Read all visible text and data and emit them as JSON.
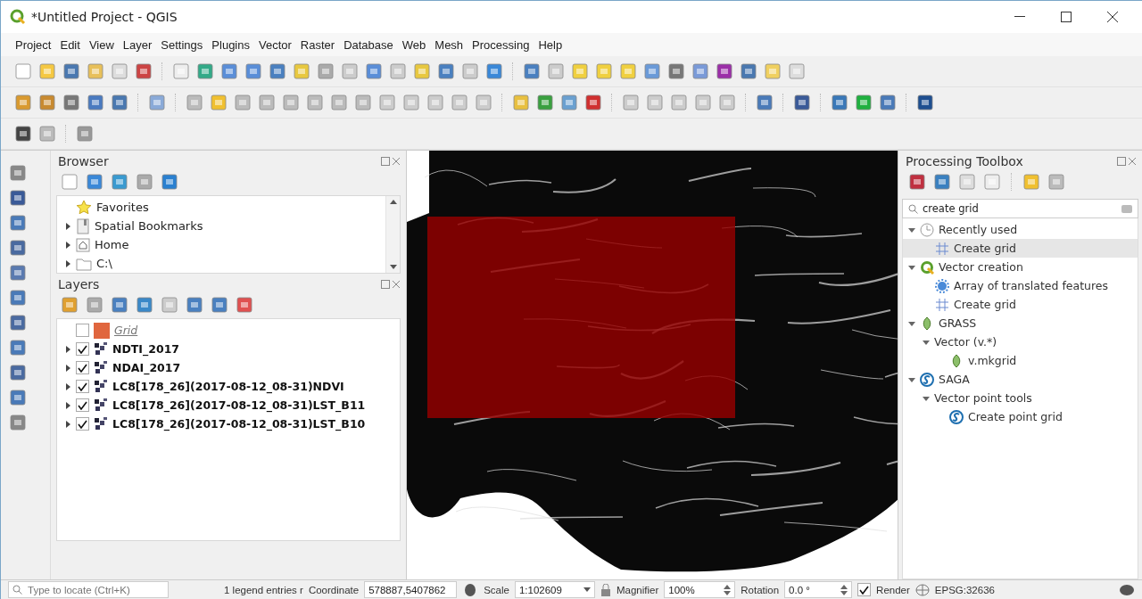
{
  "window": {
    "title": "*Untitled Project - QGIS"
  },
  "menu": [
    "Project",
    "Edit",
    "View",
    "Layer",
    "Settings",
    "Plugins",
    "Vector",
    "Raster",
    "Database",
    "Web",
    "Mesh",
    "Processing",
    "Help"
  ],
  "browser": {
    "title": "Browser",
    "items": [
      {
        "label": "Favorites",
        "kind": "star",
        "collapsible": false
      },
      {
        "label": "Spatial Bookmarks",
        "kind": "bookmark",
        "collapsible": true
      },
      {
        "label": "Home",
        "kind": "home",
        "collapsible": true
      },
      {
        "label": "C:\\",
        "kind": "folder",
        "collapsible": true
      }
    ]
  },
  "layers": {
    "title": "Layers",
    "items": [
      {
        "name": "Grid",
        "kind": "vector",
        "checked": false,
        "color": "#e0663e"
      },
      {
        "name": "NDTI_2017",
        "kind": "raster",
        "checked": true
      },
      {
        "name": "NDAI_2017",
        "kind": "raster",
        "checked": true
      },
      {
        "name": "LC8[178_26](2017-08-12_08-31)NDVI",
        "kind": "raster",
        "checked": true
      },
      {
        "name": "LC8[178_26](2017-08-12_08-31)LST_B11",
        "kind": "raster",
        "checked": true
      },
      {
        "name": "LC8[178_26](2017-08-12_08-31)LST_B10",
        "kind": "raster",
        "checked": true
      }
    ]
  },
  "toolbox": {
    "title": "Processing Toolbox",
    "search": "create grid",
    "tree": [
      {
        "label": "Recently used",
        "kind": "clock",
        "expanded": true,
        "children": [
          {
            "label": "Create grid",
            "kind": "grid",
            "selected": true
          }
        ]
      },
      {
        "label": "Vector creation",
        "kind": "qgis",
        "expanded": true,
        "children": [
          {
            "label": "Array of translated features",
            "kind": "gear",
            "selected": false
          },
          {
            "label": "Create grid",
            "kind": "grid",
            "selected": false
          }
        ]
      },
      {
        "label": "GRASS",
        "kind": "grass",
        "expanded": true,
        "children": [
          {
            "label": "Vector (v.*)",
            "kind": "none",
            "expanded": true,
            "children": [
              {
                "label": "v.mkgrid",
                "kind": "grass",
                "selected": false
              }
            ]
          }
        ]
      },
      {
        "label": "SAGA",
        "kind": "saga",
        "expanded": true,
        "children": [
          {
            "label": "Vector point tools",
            "kind": "none",
            "expanded": true,
            "children": [
              {
                "label": "Create point grid",
                "kind": "saga",
                "selected": false
              }
            ]
          }
        ]
      }
    ]
  },
  "status": {
    "locate_placeholder": "Type to locate (Ctrl+K)",
    "legend": "1 legend entries r",
    "coordinate_label": "Coordinate",
    "coordinate": "578887,5407862",
    "scale_label": "Scale",
    "scale": "1:102609",
    "magnifier_label": "Magnifier",
    "magnifier": "100%",
    "rotation_label": "Rotation",
    "rotation": "0.0 °",
    "render_label": "Render",
    "render_checked": true,
    "crs": "EPSG:32636"
  }
}
